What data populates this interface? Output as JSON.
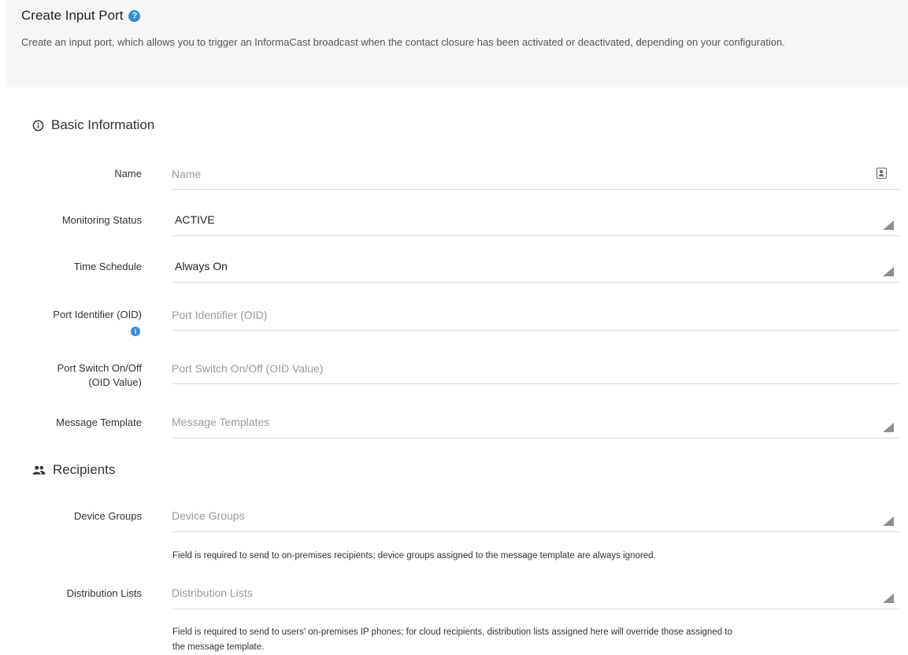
{
  "header": {
    "title": "Create Input Port",
    "description": "Create an input port, which allows you to trigger an InformaCast broadcast when the contact closure has been activated or deactivated, depending on your configuration."
  },
  "basic_info": {
    "title": "Basic Information",
    "name": {
      "label": "Name",
      "placeholder": "Name",
      "value": ""
    },
    "monitoring_status": {
      "label": "Monitoring Status",
      "value": "ACTIVE"
    },
    "time_schedule": {
      "label": "Time Schedule",
      "value": "Always On"
    },
    "port_identifier": {
      "label": "Port Identifier (OID)",
      "placeholder": "Port Identifier (OID)",
      "value": ""
    },
    "port_switch": {
      "label_line1": "Port Switch On/Off",
      "label_line2": "(OID Value)",
      "placeholder": "Port Switch On/Off (OID Value)",
      "value": ""
    },
    "message_template": {
      "label": "Message Template",
      "placeholder": "Message Templates"
    }
  },
  "recipients": {
    "title": "Recipients",
    "device_groups": {
      "label": "Device Groups",
      "placeholder": "Device Groups",
      "helper": "Field is required to send to on-premises recipients; device groups assigned to the message template are always ignored."
    },
    "distribution_lists": {
      "label": "Distribution Lists",
      "placeholder": "Distribution Lists",
      "helper_line1": "Field is required to send to users' on-premises IP phones; for cloud recipients, distribution lists assigned here will override those assigned to",
      "helper_line2": "the message template."
    }
  },
  "icons": {
    "help": "help-icon",
    "info": "info-circle-icon",
    "contact": "contact-card-icon",
    "people": "people-icon",
    "dropdown": "dropdown-arrow-icon"
  },
  "colors": {
    "accent": "#2f8fd8",
    "header_bg": "#f6f6f6",
    "divider": "#d8d8d8"
  }
}
